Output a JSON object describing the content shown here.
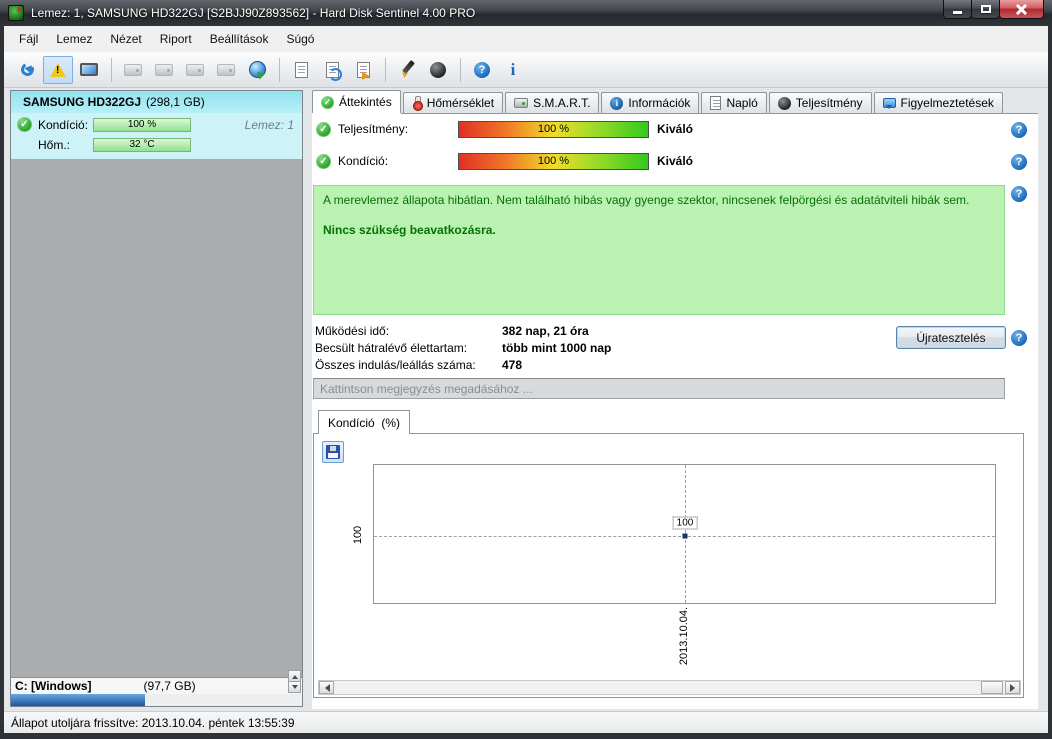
{
  "window": {
    "title": "Lemez: 1, SAMSUNG HD322GJ [S2BJJ90Z893562]  -  Hard Disk Sentinel 4.00 PRO"
  },
  "menu": {
    "items": [
      "Fájl",
      "Lemez",
      "Nézet",
      "Riport",
      "Beállítások",
      "Súgó"
    ]
  },
  "toolbar": {
    "icons": [
      "refresh",
      "warning-acknowledge",
      "disk-monitor",
      "disk-nav-1",
      "disk-nav-2",
      "disk-nav-3",
      "disk-nav-4",
      "globe-online",
      "report",
      "report-refresh",
      "report-announce",
      "pen-register",
      "disk-platter",
      "help",
      "info"
    ]
  },
  "sidebar": {
    "disk_name": "SAMSUNG HD322GJ",
    "disk_size": "(298,1 GB)",
    "condition_label": "Kondíció:",
    "condition_value": "100 %",
    "disk_number": "Lemez: 1",
    "temperature_label": "Hőm.:",
    "temperature_value": "32 °C",
    "partition_label": "C: [Windows]",
    "partition_size": "(97,7 GB)"
  },
  "tabs": [
    {
      "label": "Áttekintés"
    },
    {
      "label": "Hőmérséklet"
    },
    {
      "label": "S.M.A.R.T."
    },
    {
      "label": "Információk"
    },
    {
      "label": "Napló"
    },
    {
      "label": "Teljesítmény"
    },
    {
      "label": "Figyelmeztetések"
    }
  ],
  "overview": {
    "performance_label": "Teljesítmény:",
    "performance_value": "100 %",
    "performance_rating": "Kiváló",
    "condition_label": "Kondíció:",
    "condition_value": "100 %",
    "condition_rating": "Kiváló",
    "status_message": "A merevlemez állapota hibátlan. Nem található hibás vagy gyenge szektor, nincsenek felpörgési és adatátviteli hibák sem.",
    "status_action": "Nincs szükség beavatkozásra.",
    "stats": [
      {
        "label": "Működési idő:",
        "value": "382 nap, 21 óra"
      },
      {
        "label": "Becsült hátralévő élettartam:",
        "value": "több mint 1000 nap"
      },
      {
        "label": "Összes indulás/leállás száma:",
        "value": "478"
      }
    ],
    "retest_button": "Újratesztelés",
    "comment_placeholder": "Kattintson megjegyzés megadásához ..."
  },
  "chart": {
    "tab_label": "Kondíció  (%)",
    "y_axis_label": "100",
    "point_label": "100",
    "x_axis_label": "2013.10.04."
  },
  "chart_data": {
    "type": "line",
    "title": "Kondíció (%)",
    "x": [
      "2013.10.04."
    ],
    "series": [
      {
        "name": "Kondíció",
        "values": [
          100
        ]
      }
    ],
    "ylabel": "Kondíció (%)",
    "ylim": [
      0,
      100
    ],
    "grid": "dashed",
    "legend": "none"
  },
  "statusbar": {
    "text": "Állapot utoljára frissítve: 2013.10.04. péntek 13:55:39"
  }
}
